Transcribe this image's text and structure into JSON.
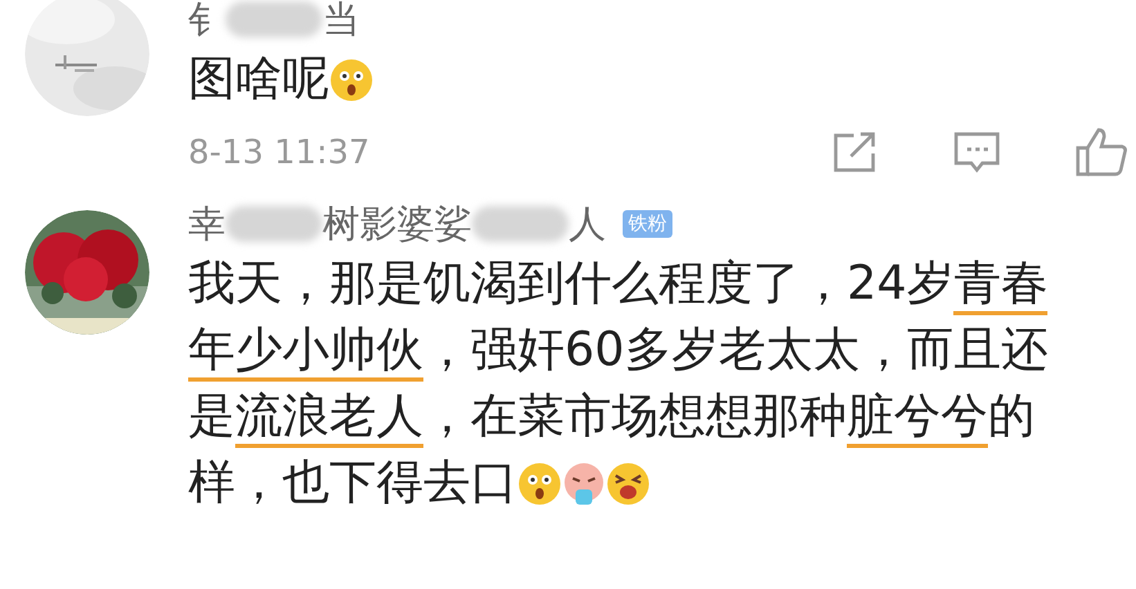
{
  "comments": [
    {
      "avatar": {
        "kind": "picture"
      },
      "name_parts": [
        {
          "kind": "text",
          "text": "钅"
        },
        {
          "kind": "blur"
        },
        {
          "kind": "text",
          "text": "当"
        }
      ],
      "lines": [
        [
          {
            "kind": "text",
            "text": "图啥呢",
            "underlined": false
          },
          {
            "kind": "emoji"
          }
        ]
      ],
      "time": "8-13 11:37"
    },
    {
      "avatar": {
        "kind": "picture"
      },
      "name_parts": [
        {
          "kind": "text",
          "text": "幸"
        },
        {
          "kind": "blur"
        },
        {
          "kind": "text",
          "text": "树影婆娑"
        },
        {
          "kind": "blur"
        },
        {
          "kind": "text",
          "text": "人"
        }
      ],
      "badge": "铁粉",
      "lines": [
        [
          {
            "kind": "text",
            "text": "我天，那是饥渴到什么程度了，24岁",
            "underlined": false
          },
          {
            "kind": "text",
            "text": "青春",
            "underlined": true
          }
        ],
        [
          {
            "kind": "text",
            "text": "年少小帅伙",
            "underlined": true
          },
          {
            "kind": "text",
            "text": "，强奸60多岁老太太，而且还",
            "underlined": false
          }
        ],
        [
          {
            "kind": "text",
            "text": "是",
            "underlined": false
          },
          {
            "kind": "text",
            "text": "流浪老人",
            "underlined": true
          },
          {
            "kind": "text",
            "text": "，在菜市场想想那种",
            "underlined": false
          },
          {
            "kind": "text",
            "text": "脏兮兮",
            "underlined": true
          },
          {
            "kind": "text",
            "text": "的",
            "underlined": false
          }
        ],
        [
          {
            "kind": "text",
            "text": "样，也下得去口",
            "underlined": false
          },
          {
            "kind": "emoji"
          },
          {
            "kind": "emoji"
          },
          {
            "kind": "emoji"
          }
        ]
      ]
    }
  ]
}
